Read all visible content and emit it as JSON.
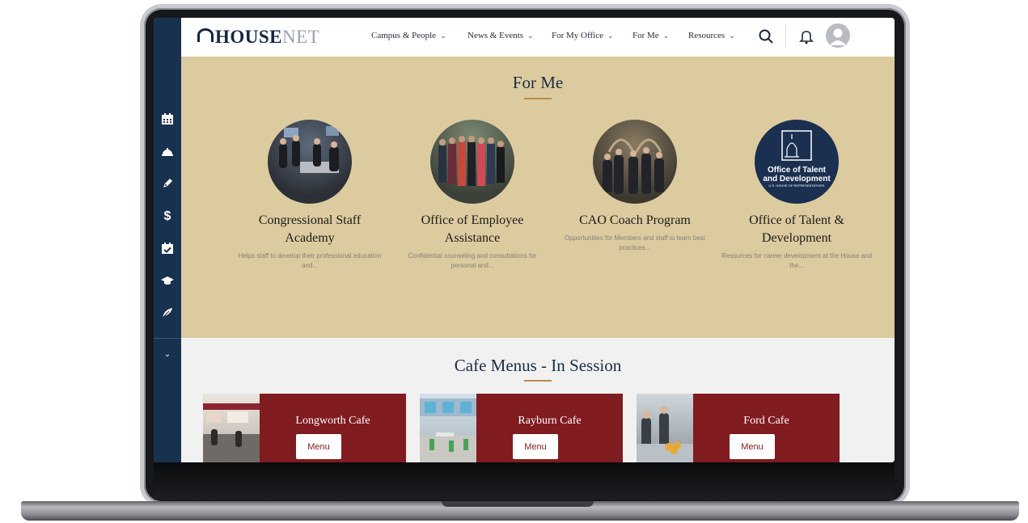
{
  "logo": {
    "house": "HOUSE",
    "net": "NET"
  },
  "nav": [
    {
      "label": "Campus & People"
    },
    {
      "label": "News & Events"
    },
    {
      "label": "For My Office"
    },
    {
      "label": "For Me"
    },
    {
      "label": "Resources"
    }
  ],
  "sidebar_icons": [
    "calendar-icon",
    "service-bell-icon",
    "pen-icon",
    "dollar-icon",
    "calendar-check-icon",
    "graduation-cap-icon",
    "feather-icon",
    "chevron-down-icon"
  ],
  "for_me": {
    "title": "For Me",
    "cards": [
      {
        "title": "Congressional Staff Academy",
        "description": "Helps staff to develop their professional education and..."
      },
      {
        "title": "Office of Employee Assistance",
        "description": "Confidential counseling and consultations for personal and..."
      },
      {
        "title": "CAO Coach Program",
        "description": "Opportunities for Members and staff to learn best practices..."
      },
      {
        "title": "Office of Talent & Development",
        "description": "Resources for career development at the House and the...",
        "badge_line1": "Office of Talent",
        "badge_line2": "and Development",
        "badge_small": "U.S. HOUSE OF REPRESENTATIVES"
      }
    ]
  },
  "cafe_menus": {
    "title": "Cafe Menus - In Session",
    "cafes": [
      {
        "name": "Longworth Cafe",
        "button": "Menu"
      },
      {
        "name": "Rayburn Cafe",
        "button": "Menu"
      },
      {
        "name": "Ford Cafe",
        "button": "Menu"
      }
    ]
  },
  "colors": {
    "navy": "#18314f",
    "gold_band": "#dccb9f",
    "maroon": "#801b20",
    "accent_rule": "#b98d4a"
  }
}
